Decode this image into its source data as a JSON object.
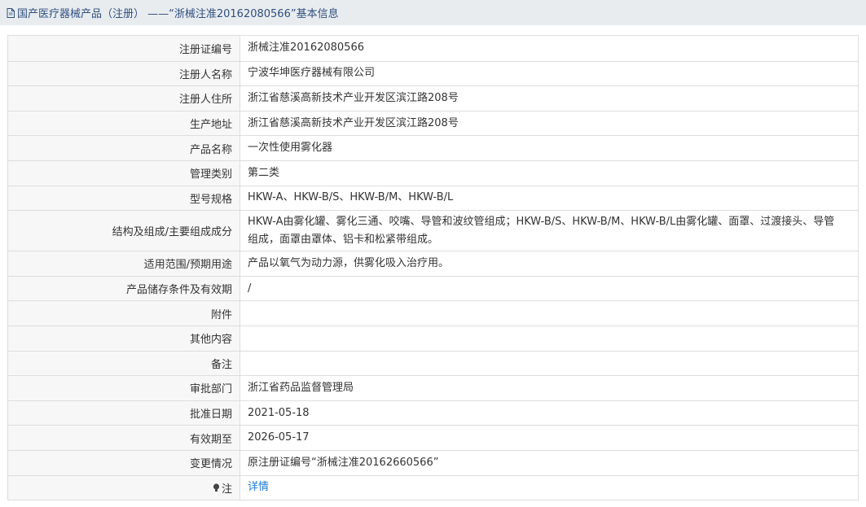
{
  "header": {
    "icon": "document-icon",
    "title": "国产医疗器械产品（注册） ——“浙械注准20162080566”基本信息"
  },
  "rows": [
    {
      "label": "注册证编号",
      "value": "浙械注准20162080566"
    },
    {
      "label": "注册人名称",
      "value": "宁波华坤医疗器械有限公司"
    },
    {
      "label": "注册人住所",
      "value": "浙江省慈溪高新技术产业开发区滨江路208号"
    },
    {
      "label": "生产地址",
      "value": "浙江省慈溪高新技术产业开发区滨江路208号"
    },
    {
      "label": "产品名称",
      "value": "一次性使用雾化器"
    },
    {
      "label": "管理类别",
      "value": "第二类"
    },
    {
      "label": "型号规格",
      "value": "HKW-A、HKW-B/S、HKW-B/M、HKW-B/L"
    },
    {
      "label": "结构及组成/主要组成成分",
      "value": "HKW-A由雾化罐、雾化三通、咬嘴、导管和波纹管组成；HKW-B/S、HKW-B/M、HKW-B/L由雾化罐、面罩、过渡接头、导管组成，面罩由罩体、铝卡和松紧带组成。"
    },
    {
      "label": "适用范围/预期用途",
      "value": "产品以氧气为动力源，供雾化吸入治疗用。"
    },
    {
      "label": "产品储存条件及有效期",
      "value": "/"
    },
    {
      "label": "附件",
      "value": ""
    },
    {
      "label": "其他内容",
      "value": ""
    },
    {
      "label": "备注",
      "value": ""
    },
    {
      "label": "审批部门",
      "value": "浙江省药品监督管理局"
    },
    {
      "label": "批准日期",
      "value": "2021-05-18"
    },
    {
      "label": "有效期至",
      "value": "2026-05-17"
    },
    {
      "label": "变更情况",
      "value": "原注册证编号“浙械注准20162660566”"
    }
  ],
  "note_row": {
    "icon": "lightbulb-icon",
    "label": "注",
    "link_text": "详情"
  }
}
